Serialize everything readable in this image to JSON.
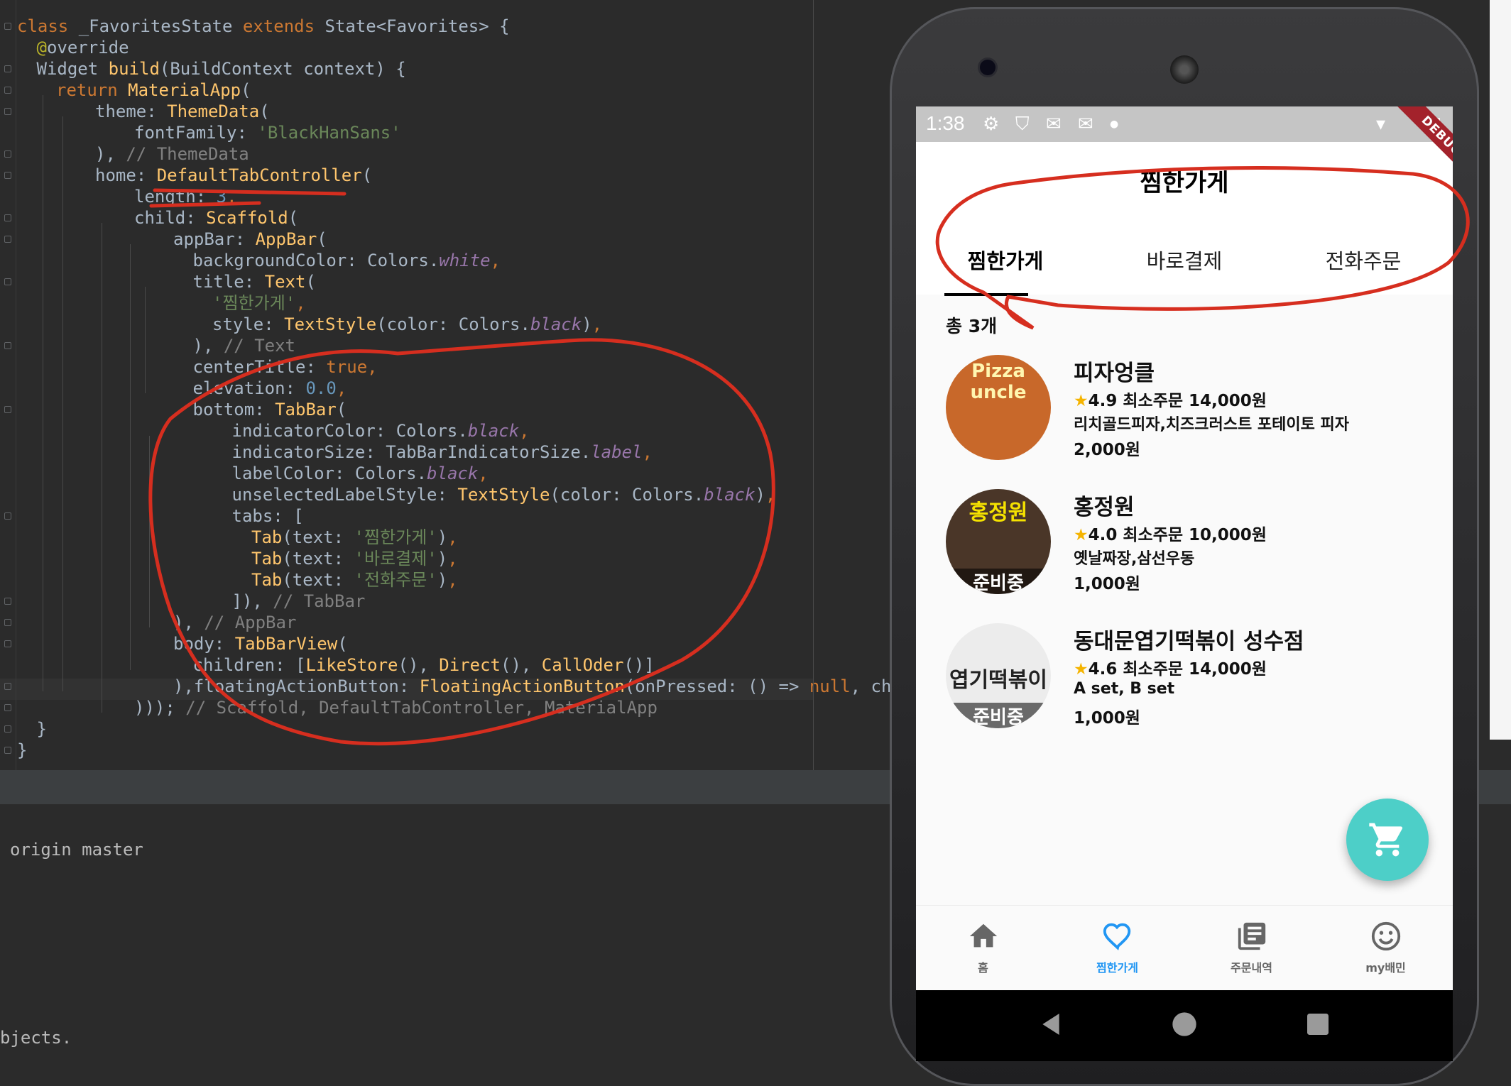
{
  "code_lines": [
    {
      "indent": 0,
      "tokens": [
        [
          "kw",
          "class "
        ],
        [
          "",
          "_FavoritesState "
        ],
        [
          "kw",
          "extends "
        ],
        [
          "",
          "State<Favorites> {"
        ]
      ]
    },
    {
      "indent": 1,
      "tokens": [
        [
          "ann",
          "@"
        ],
        [
          "",
          "override"
        ]
      ]
    },
    {
      "indent": 1,
      "tokens": [
        [
          "",
          "Widget "
        ],
        [
          "fn",
          "build"
        ],
        [
          "",
          "(BuildContext context) {"
        ]
      ]
    },
    {
      "indent": 2,
      "tokens": [
        [
          "kw",
          "return "
        ],
        [
          "fn",
          "MaterialApp"
        ],
        [
          "",
          "("
        ]
      ]
    },
    {
      "indent": 4,
      "tokens": [
        [
          "",
          "theme: "
        ],
        [
          "fn",
          "ThemeData"
        ],
        [
          "",
          "("
        ]
      ]
    },
    {
      "indent": 6,
      "tokens": [
        [
          "",
          "fontFamily: "
        ],
        [
          "str",
          "'BlackHanSans'"
        ]
      ]
    },
    {
      "indent": 4,
      "tokens": [
        [
          "",
          "), "
        ],
        [
          "cm",
          "// ThemeData"
        ]
      ]
    },
    {
      "indent": 4,
      "tokens": [
        [
          "",
          "home: "
        ],
        [
          "fn",
          "DefaultTabController"
        ],
        [
          "",
          "("
        ]
      ]
    },
    {
      "indent": 6,
      "tokens": [
        [
          "",
          "length: "
        ],
        [
          "num",
          "3"
        ],
        [
          "kw",
          ","
        ]
      ]
    },
    {
      "indent": 6,
      "tokens": [
        [
          "",
          "child: "
        ],
        [
          "fn",
          "Scaffold"
        ],
        [
          "",
          "("
        ]
      ]
    },
    {
      "indent": 8,
      "tokens": [
        [
          "",
          "appBar: "
        ],
        [
          "fn",
          "AppBar"
        ],
        [
          "",
          "("
        ]
      ]
    },
    {
      "indent": 9,
      "tokens": [
        [
          "",
          "backgroundColor: Colors."
        ],
        [
          "it",
          "white"
        ],
        [
          "kw",
          ","
        ]
      ]
    },
    {
      "indent": 9,
      "tokens": [
        [
          "",
          "title: "
        ],
        [
          "fn",
          "Text"
        ],
        [
          "",
          "("
        ]
      ]
    },
    {
      "indent": 10,
      "tokens": [
        [
          "str",
          "'찜한가게'"
        ],
        [
          "kw",
          ","
        ]
      ]
    },
    {
      "indent": 10,
      "tokens": [
        [
          "",
          "style: "
        ],
        [
          "fn",
          "TextStyle"
        ],
        [
          "",
          "(color: Colors."
        ],
        [
          "it",
          "black"
        ],
        [
          "",
          ")"
        ],
        [
          "kw",
          ","
        ]
      ]
    },
    {
      "indent": 9,
      "tokens": [
        [
          "",
          "), "
        ],
        [
          "cm",
          "// Text"
        ]
      ]
    },
    {
      "indent": 9,
      "tokens": [
        [
          "",
          "centerTitle: "
        ],
        [
          "kw",
          "true"
        ],
        [
          "kw",
          ","
        ]
      ]
    },
    {
      "indent": 9,
      "tokens": [
        [
          "",
          "elevation: "
        ],
        [
          "num",
          "0.0"
        ],
        [
          "kw",
          ","
        ]
      ]
    },
    {
      "indent": 9,
      "tokens": [
        [
          "",
          "bottom: "
        ],
        [
          "fn",
          "TabBar"
        ],
        [
          "",
          "("
        ]
      ]
    },
    {
      "indent": 11,
      "tokens": [
        [
          "",
          "indicatorColor: Colors."
        ],
        [
          "it",
          "black"
        ],
        [
          "kw",
          ","
        ]
      ]
    },
    {
      "indent": 11,
      "tokens": [
        [
          "",
          "indicatorSize: TabBarIndicatorSize."
        ],
        [
          "it",
          "label"
        ],
        [
          "kw",
          ","
        ]
      ]
    },
    {
      "indent": 11,
      "tokens": [
        [
          "",
          "labelColor: Colors."
        ],
        [
          "it",
          "black"
        ],
        [
          "kw",
          ","
        ]
      ]
    },
    {
      "indent": 11,
      "tokens": [
        [
          "",
          "unselectedLabelStyle: "
        ],
        [
          "fn",
          "TextStyle"
        ],
        [
          "",
          "(color: Colors."
        ],
        [
          "it",
          "black"
        ],
        [
          "",
          ")"
        ],
        [
          "kw",
          ","
        ]
      ]
    },
    {
      "indent": 11,
      "tokens": [
        [
          "",
          "tabs: ["
        ]
      ]
    },
    {
      "indent": 12,
      "tokens": [
        [
          "fn",
          "Tab"
        ],
        [
          "",
          "(text: "
        ],
        [
          "str",
          "'찜한가게'"
        ],
        [
          "",
          ")"
        ],
        [
          "kw",
          ","
        ]
      ]
    },
    {
      "indent": 12,
      "tokens": [
        [
          "fn",
          "Tab"
        ],
        [
          "",
          "(text: "
        ],
        [
          "str",
          "'바로결제'"
        ],
        [
          "",
          ")"
        ],
        [
          "kw",
          ","
        ]
      ]
    },
    {
      "indent": 12,
      "tokens": [
        [
          "fn",
          "Tab"
        ],
        [
          "",
          "(text: "
        ],
        [
          "str",
          "'전화주문'"
        ],
        [
          "",
          ")"
        ],
        [
          "kw",
          ","
        ]
      ]
    },
    {
      "indent": 11,
      "tokens": [
        [
          "",
          "]), "
        ],
        [
          "cm",
          "// TabBar"
        ]
      ]
    },
    {
      "indent": 8,
      "tokens": [
        [
          "",
          "), "
        ],
        [
          "cm",
          "// AppBar"
        ]
      ]
    },
    {
      "indent": 8,
      "tokens": [
        [
          "",
          "body: "
        ],
        [
          "fn",
          "TabBarView"
        ],
        [
          "",
          "("
        ]
      ]
    },
    {
      "indent": 9,
      "tokens": [
        [
          "",
          "children: ["
        ],
        [
          "fn",
          "LikeStore"
        ],
        [
          "",
          "(), "
        ],
        [
          "fn",
          "Direct"
        ],
        [
          "",
          "(), "
        ],
        [
          "fn",
          "CallOder"
        ],
        [
          "",
          "()]"
        ]
      ]
    },
    {
      "indent": 8,
      "tokens": [
        [
          "",
          "),floatingActionButton: "
        ],
        [
          "fn",
          "FloatingActionButton"
        ],
        [
          "",
          "(onPressed: () => "
        ],
        [
          "kw",
          "null"
        ],
        [
          "",
          ", chi"
        ]
      ]
    },
    {
      "indent": 6,
      "tokens": [
        [
          "",
          ")));"
        ],
        [
          "cm",
          " // Scaffold, DefaultTabController, MaterialApp"
        ]
      ]
    },
    {
      "indent": 1,
      "tokens": [
        [
          "",
          "}"
        ]
      ]
    },
    {
      "indent": 0,
      "tokens": [
        [
          "",
          "}"
        ]
      ]
    }
  ],
  "terminal": {
    "line1": "origin master",
    "line2": "bjects."
  },
  "phone": {
    "status_time": "1:38",
    "debug_banner": "DEBUG",
    "app_title": "찜한가게",
    "tabs": [
      "찜한가게",
      "바로결제",
      "전화주문"
    ],
    "selected_tab": 0,
    "count_label": "총 3개",
    "stores": [
      {
        "name": "피자엉클",
        "rating": "4.9",
        "min_order": "최소주문 14,000원",
        "menu": "리치골드피자,치즈크러스트 포테이토 피자",
        "delivery_fee": "2,000원",
        "thumb_text": "Pizza uncle",
        "thumb_color": "#c8682a"
      },
      {
        "name": "홍정원",
        "rating": "4.0",
        "min_order": "최소주문 10,000원",
        "menu": "옛날짜장,삼선우동",
        "delivery_fee": "1,000원",
        "thumb_text": "홍정원",
        "thumb_badge": "준비중",
        "thumb_color": "#4a3628"
      },
      {
        "name": "동대문엽기떡볶이 성수점",
        "rating": "4.6",
        "min_order": "최소주문 14,000원",
        "menu": "A set, B set",
        "delivery_fee": "1,000원",
        "thumb_text": "엽기떡볶이",
        "thumb_badge": "준비중",
        "thumb_color": "#ececec"
      }
    ],
    "bottom_nav": [
      {
        "label": "홈",
        "icon": "home-icon"
      },
      {
        "label": "찜한가게",
        "icon": "heart-icon"
      },
      {
        "label": "주문내역",
        "icon": "receipt-icon"
      },
      {
        "label": "my배민",
        "icon": "smile-icon"
      }
    ],
    "selected_nav": 1
  },
  "colors": {
    "accent": "#4dcfc8",
    "nav_selected": "#2196f3",
    "annotation": "#d62e1f"
  }
}
